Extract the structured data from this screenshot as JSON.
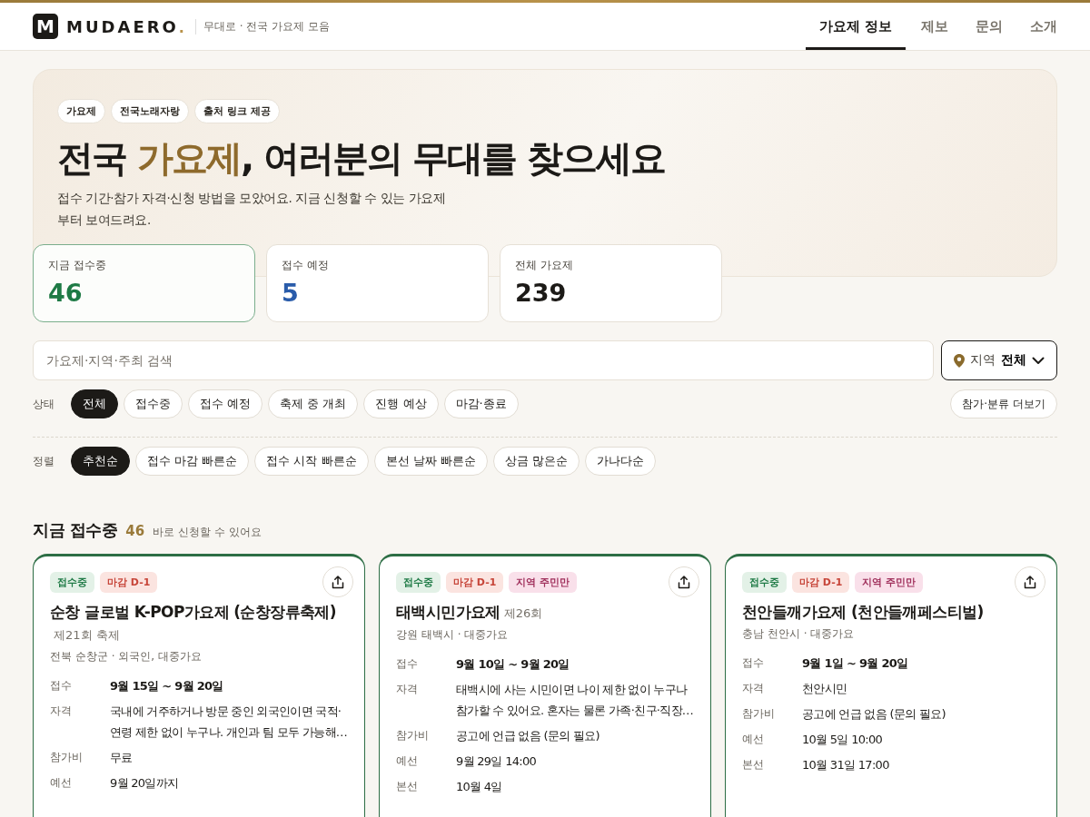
{
  "header": {
    "logo_letter": "M",
    "brand": "MUDAERO",
    "brand_dot": ".",
    "tagline": "무대로 · 전국 가요제 모음",
    "nav": [
      {
        "label": "가요제 정보",
        "selected": true
      },
      {
        "label": "제보",
        "selected": false
      },
      {
        "label": "문의",
        "selected": false
      },
      {
        "label": "소개",
        "selected": false
      }
    ]
  },
  "hero": {
    "chips": [
      "가요제",
      "전국노래자랑",
      "출처 링크 제공"
    ],
    "title_parts": [
      {
        "text": "전국 ",
        "highlight": false
      },
      {
        "text": "가요제",
        "highlight": true
      },
      {
        "text": ", 여러분의 무대를 찾으세요",
        "highlight": false
      }
    ],
    "description": "접수 기간·참가 자격·신청 방법을 모았어요. 지금 신청할 수 있는 가요제부터 보여드려요."
  },
  "stats": [
    {
      "label": "지금 접수중",
      "value": "46",
      "color": "#1e7a45",
      "selected": true
    },
    {
      "label": "접수 예정",
      "value": "5",
      "color": "#2a5caa",
      "selected": false
    },
    {
      "label": "전체 가요제",
      "value": "239",
      "color": "#1c1a17",
      "selected": false
    }
  ],
  "search": {
    "placeholder": "가요제·지역·주최 검색"
  },
  "region": {
    "label": "지역",
    "value": "전체"
  },
  "status_filter": {
    "label": "상태",
    "options": [
      {
        "label": "전체",
        "selected": true
      },
      {
        "label": "접수중",
        "selected": false
      },
      {
        "label": "접수 예정",
        "selected": false
      },
      {
        "label": "축제 중 개최",
        "selected": false
      },
      {
        "label": "진행 예상",
        "selected": false
      },
      {
        "label": "마감·종료",
        "selected": false
      }
    ],
    "more_button": "참가·분류 더보기"
  },
  "sort": {
    "label": "정렬",
    "options": [
      {
        "label": "추천순",
        "selected": true
      },
      {
        "label": "접수 마감 빠른순",
        "selected": false
      },
      {
        "label": "접수 시작 빠른순",
        "selected": false
      },
      {
        "label": "본선 날짜 빠른순",
        "selected": false
      },
      {
        "label": "상금 많은순",
        "selected": false
      },
      {
        "label": "가나다순",
        "selected": false
      }
    ]
  },
  "section": {
    "title": "지금 접수중",
    "count": "46",
    "subtitle": "바로 신청할 수 있어요"
  },
  "cards": [
    {
      "tags": [
        {
          "label": "접수중",
          "kind": "status"
        },
        {
          "label": "마감 D-1",
          "kind": "deadline"
        }
      ],
      "title": "순창 글로벌 K-POP가요제 (순창장류축제)",
      "edition": "제21회 축제",
      "meta": "전북 순창군 · 외국인, 대중가요",
      "rows": [
        {
          "label": "접수",
          "value": "9월 15일 ~ 9월 20일"
        },
        {
          "label": "자격",
          "value": "국내에 거주하거나 방문 중인 외국인이면 국적·연령 제한 없이 누구나. 개인과 팀 모두 가능해…"
        },
        {
          "label": "참가비",
          "value": "무료"
        },
        {
          "label": "예선",
          "value": "9월 20일까지"
        }
      ]
    },
    {
      "tags": [
        {
          "label": "접수중",
          "kind": "status"
        },
        {
          "label": "마감 D-1",
          "kind": "deadline"
        },
        {
          "label": "지역 주민만",
          "kind": "local"
        }
      ],
      "title": "태백시민가요제",
      "edition": "제26회",
      "meta": "강원 태백시 · 대중가요",
      "rows": [
        {
          "label": "접수",
          "value": "9월 10일 ~ 9월 20일"
        },
        {
          "label": "자격",
          "value": "태백시에 사는 시민이면 나이 제한 없이 누구나 참가할 수 있어요. 혼자는 물론 가족·친구·직장…"
        },
        {
          "label": "참가비",
          "value": "공고에 언급 없음 (문의 필요)"
        },
        {
          "label": "예선",
          "value": "9월 29일 14:00"
        },
        {
          "label": "본선",
          "value": "10월 4일"
        }
      ]
    },
    {
      "tags": [
        {
          "label": "접수중",
          "kind": "status"
        },
        {
          "label": "마감 D-1",
          "kind": "deadline"
        },
        {
          "label": "지역 주민만",
          "kind": "local"
        }
      ],
      "title": "천안들깨가요제 (천안들깨페스티벌)",
      "meta": "충남 천안시 · 대중가요",
      "rows": [
        {
          "label": "접수",
          "value": "9월 1일 ~ 9월 20일"
        },
        {
          "label": "자격",
          "value": "천안시민"
        },
        {
          "label": "참가비",
          "value": "공고에 언급 없음 (문의 필요)"
        },
        {
          "label": "예선",
          "value": "10월 5일 10:00"
        },
        {
          "label": "본선",
          "value": "10월 31일 17:00"
        }
      ]
    }
  ]
}
